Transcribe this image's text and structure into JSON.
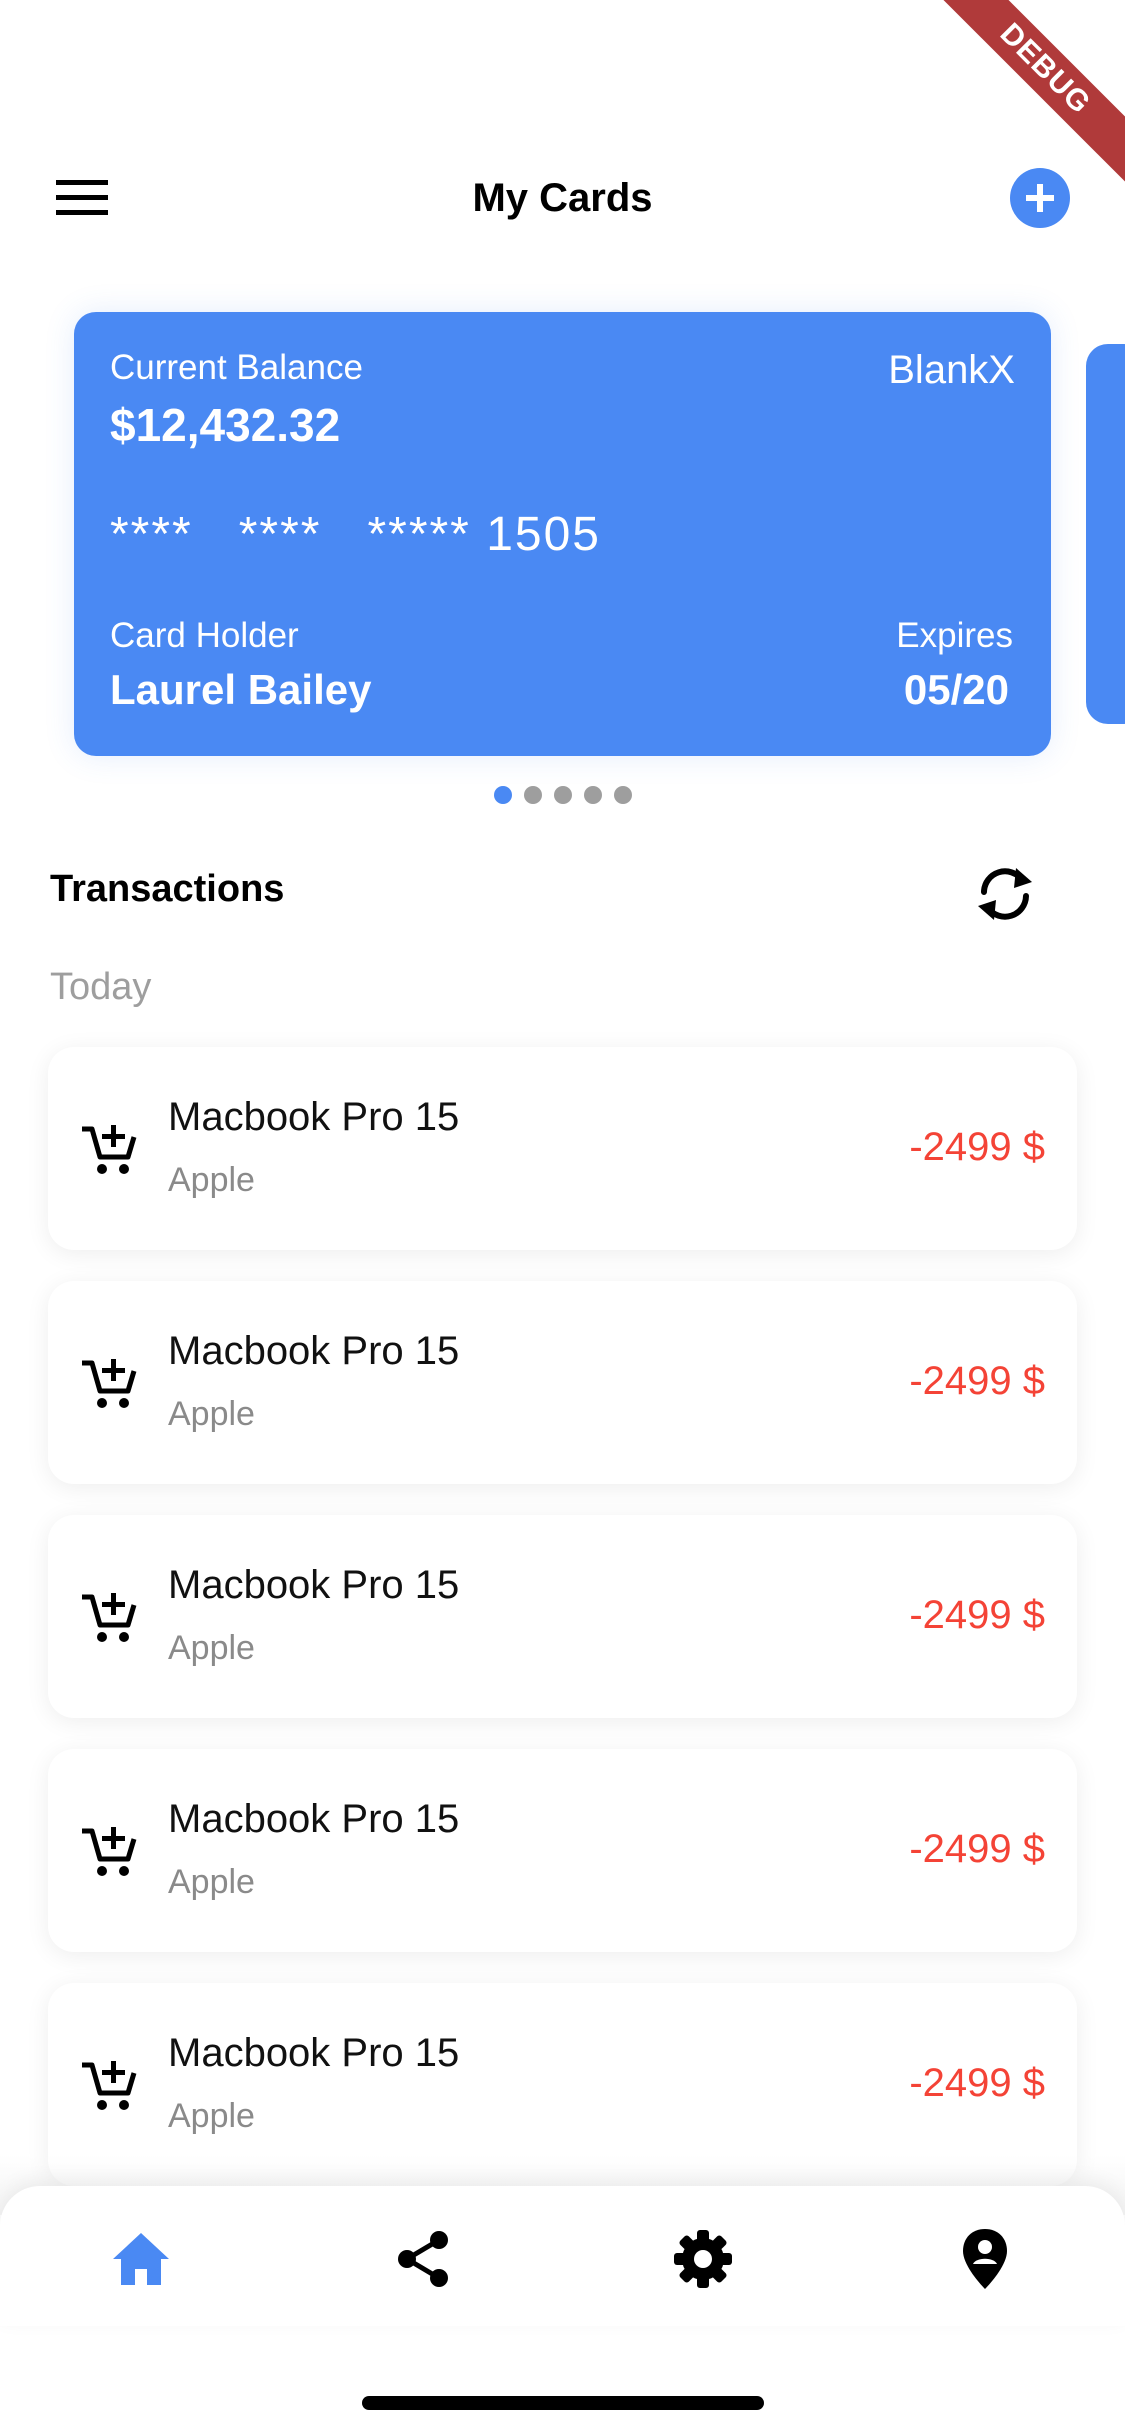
{
  "debug_banner": "DEBUG",
  "header": {
    "title": "My Cards"
  },
  "card": {
    "balance_label": "Current Balance",
    "balance": "$12,432.32",
    "brand": "BlankX",
    "number": "****   ****   ***** 1505",
    "holder_label": "Card Holder",
    "holder": "Laurel Bailey",
    "expires_label": "Expires",
    "expires": "05/20",
    "color": "#4A89F3"
  },
  "pager": {
    "count": 5,
    "active_index": 0
  },
  "transactions": {
    "title": "Transactions",
    "day_label": "Today",
    "items": [
      {
        "name": "Macbook Pro 15",
        "vendor": "Apple",
        "amount": "-2499 $"
      },
      {
        "name": "Macbook Pro 15",
        "vendor": "Apple",
        "amount": "-2499 $"
      },
      {
        "name": "Macbook Pro 15",
        "vendor": "Apple",
        "amount": "-2499 $"
      },
      {
        "name": "Macbook Pro 15",
        "vendor": "Apple",
        "amount": "-2499 $"
      },
      {
        "name": "Macbook Pro 15",
        "vendor": "Apple",
        "amount": "-2499 $"
      }
    ]
  },
  "bottom_nav": {
    "items": [
      {
        "icon": "home-icon",
        "active": true
      },
      {
        "icon": "share-icon",
        "active": false
      },
      {
        "icon": "gear-icon",
        "active": false
      },
      {
        "icon": "location-pin-icon",
        "active": false
      }
    ]
  },
  "colors": {
    "accent": "#4A89F3",
    "negative": "#F44336",
    "muted": "#9e9e9e"
  }
}
